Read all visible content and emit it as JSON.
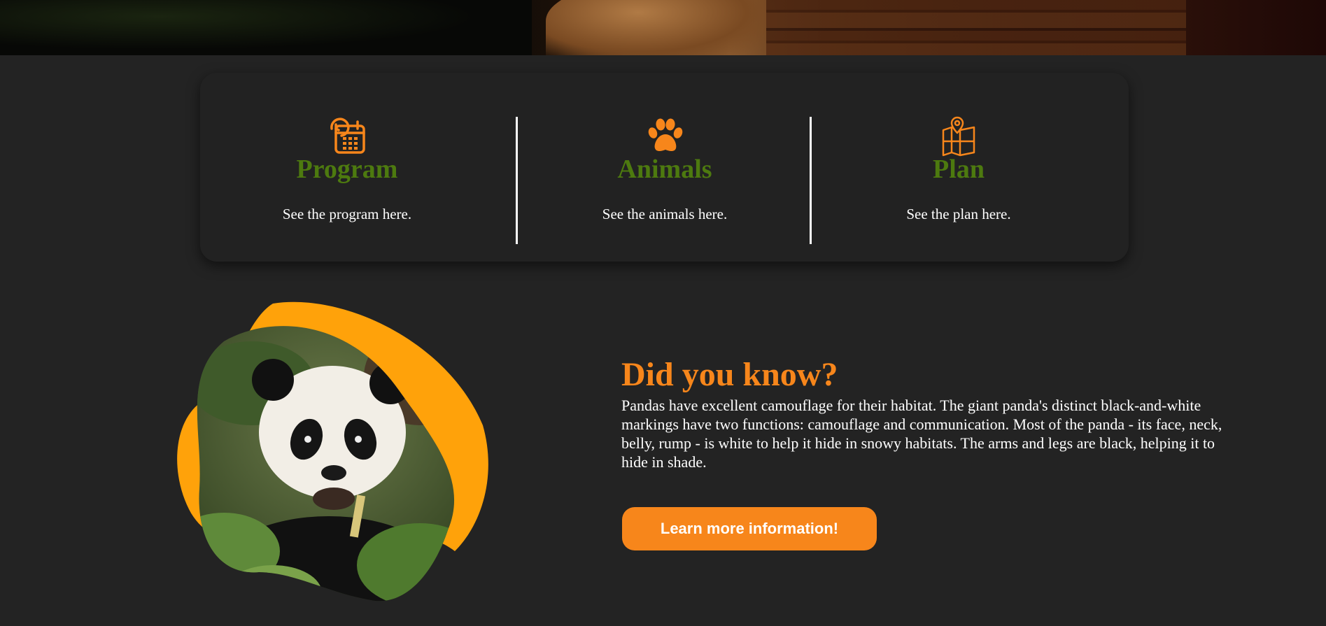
{
  "features": [
    {
      "title": "Program",
      "description": "See the program here.",
      "icon": "calendar-clock-icon"
    },
    {
      "title": "Animals",
      "description": "See the animals here.",
      "icon": "paw-icon"
    },
    {
      "title": "Plan",
      "description": "See the plan here.",
      "icon": "map-pin-icon"
    }
  ],
  "highlight": {
    "title": "Did you know?",
    "text": "Pandas have excellent camouflage for their habitat. The giant panda's distinct black-and-white markings have two functions: camouflage and communication. Most of the panda - its face, neck, belly, rump - is white to help it hide in snowy habitats. The arms and legs are black, helping it to hide in shade.",
    "button_label": "Learn more information!"
  },
  "colors": {
    "background": "#232323",
    "card": "#222222",
    "accent_orange": "#f7861b",
    "blob_orange": "#ffa20a",
    "feature_green": "#4d7a0f"
  }
}
